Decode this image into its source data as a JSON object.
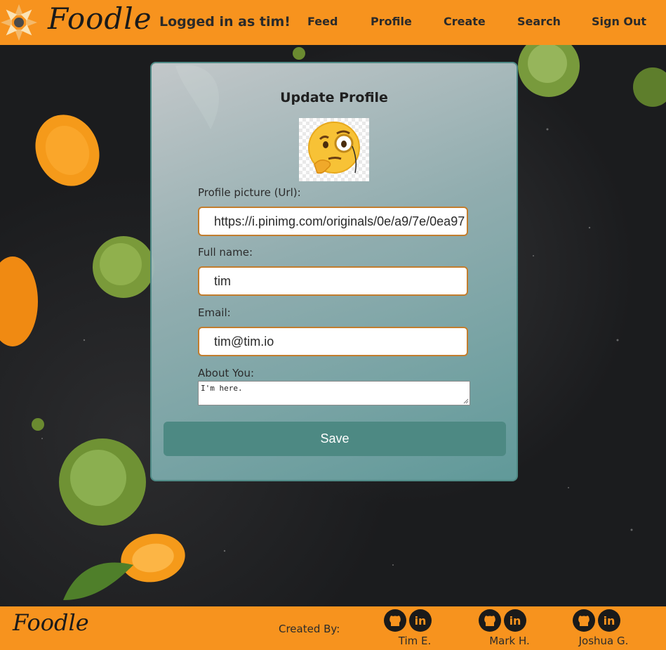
{
  "header": {
    "logo_text": "Foodle",
    "logged_in_text": "Logged in as tim!",
    "nav": {
      "feed": "Feed",
      "profile": "Profile",
      "create": "Create",
      "search": "Search",
      "sign_out": "Sign Out"
    }
  },
  "form": {
    "title": "Update Profile",
    "avatar_icon": "thinking-face-with-monocle-emoji",
    "profile_picture_label": "Profile picture (Url):",
    "profile_picture_value": "https://i.pinimg.com/originals/0e/a9/7e/0ea97",
    "full_name_label": "Full name:",
    "full_name_value": "tim",
    "email_label": "Email:",
    "email_value": "tim@tim.io",
    "about_label": "About You:",
    "about_value": "I'm here.",
    "save_label": "Save"
  },
  "footer": {
    "logo_text": "Foodle",
    "created_by_label": "Created By:",
    "authors": [
      {
        "name": "Tim E."
      },
      {
        "name": "Mark H."
      },
      {
        "name": "Joshua G."
      }
    ]
  },
  "colors": {
    "brand_orange": "#f7931e",
    "save_button": "#4d8983",
    "input_border": "#c27d2e"
  }
}
